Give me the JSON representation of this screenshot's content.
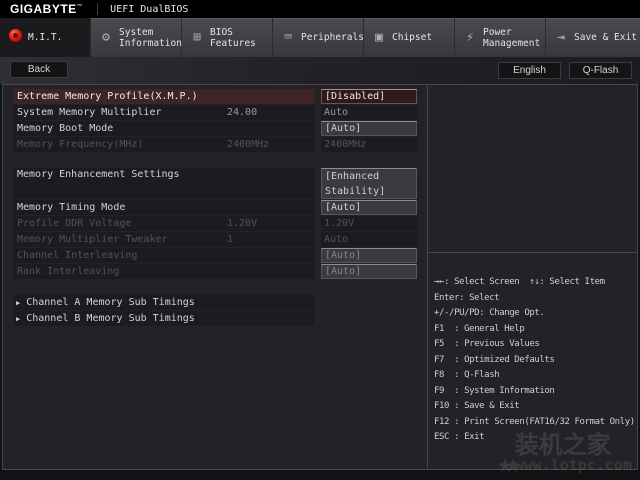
{
  "header": {
    "brand": "GIGABYTE",
    "brand_mark": "™",
    "title": "UEFI DualBIOS"
  },
  "tabs": [
    {
      "name": "mit",
      "label": "M.I.T.",
      "lines": [
        "M.I.T."
      ],
      "icon": "mit-icon",
      "active": true
    },
    {
      "name": "system-information",
      "label": "System Information",
      "lines": [
        "System",
        "Information"
      ],
      "icon": "gear-icon",
      "active": false
    },
    {
      "name": "bios-features",
      "label": "BIOS Features",
      "lines": [
        "BIOS",
        "Features"
      ],
      "icon": "bios-features-icon",
      "active": false
    },
    {
      "name": "peripherals",
      "label": "Peripherals",
      "lines": [
        "Peripherals"
      ],
      "icon": "peripherals-icon",
      "active": false
    },
    {
      "name": "chipset",
      "label": "Chipset",
      "lines": [
        "Chipset"
      ],
      "icon": "chipset-icon",
      "active": false
    },
    {
      "name": "power-management",
      "label": "Power Management",
      "lines": [
        "Power",
        "Management"
      ],
      "icon": "power-icon",
      "active": false
    },
    {
      "name": "save-exit",
      "label": "Save & Exit",
      "lines": [
        "Save & Exit"
      ],
      "icon": "save-exit-icon",
      "active": false
    }
  ],
  "icons": {
    "mit-icon": "red-dot",
    "gear-icon": "⚙",
    "bios-features-icon": "⊞",
    "peripherals-icon": "⌨",
    "chipset-icon": "▣",
    "power-icon": "⚡",
    "save-exit-icon": "⇥",
    "submenu-arrow-icon": "▶"
  },
  "subheader": {
    "back": "Back",
    "language": "English",
    "qflash": "Q-Flash"
  },
  "settings": {
    "rows": [
      {
        "label": "Extreme Memory Profile(X.M.P.)",
        "mid": "",
        "value": "[Disabled]",
        "state": "selected",
        "value_style": "box",
        "gap_before": false,
        "tall": false,
        "submenu": false
      },
      {
        "label": "System Memory Multiplier",
        "mid": "24.00",
        "value": "Auto",
        "state": "normal",
        "value_style": "text",
        "gap_before": false,
        "tall": false,
        "submenu": false
      },
      {
        "label": "Memory Boot Mode",
        "mid": "",
        "value": "[Auto]",
        "state": "normal",
        "value_style": "box",
        "gap_before": false,
        "tall": false,
        "submenu": false
      },
      {
        "label": "Memory Frequency(MHz)",
        "mid": "2400MHz",
        "value": "2400MHz",
        "state": "disabled",
        "value_style": "text",
        "gap_before": false,
        "tall": false,
        "submenu": false
      },
      {
        "label": "Memory Enhancement Settings",
        "mid": "",
        "value": "[Enhanced Stability]",
        "state": "normal",
        "value_style": "box",
        "gap_before": true,
        "tall": true,
        "submenu": false
      },
      {
        "label": "Memory Timing Mode",
        "mid": "",
        "value": "[Auto]",
        "state": "normal",
        "value_style": "box",
        "gap_before": false,
        "tall": false,
        "submenu": false
      },
      {
        "label": "Profile DDR Voltage",
        "mid": "1.20V",
        "value": "1.20V",
        "state": "disabled",
        "value_style": "text",
        "gap_before": false,
        "tall": false,
        "submenu": false
      },
      {
        "label": "Memory Multiplier Tweaker",
        "mid": "1",
        "value": "Auto",
        "state": "disabled",
        "value_style": "text",
        "gap_before": false,
        "tall": false,
        "submenu": false
      },
      {
        "label": "Channel Interleaving",
        "mid": "",
        "value": "[Auto]",
        "state": "disabled",
        "value_style": "box",
        "gap_before": false,
        "tall": false,
        "submenu": false
      },
      {
        "label": "Rank Interleaving",
        "mid": "",
        "value": "[Auto]",
        "state": "disabled",
        "value_style": "box",
        "gap_before": false,
        "tall": false,
        "submenu": false
      },
      {
        "label": "Channel A Memory Sub Timings",
        "mid": "",
        "value": "",
        "state": "normal",
        "value_style": "none",
        "gap_before": true,
        "tall": false,
        "submenu": true
      },
      {
        "label": "Channel B Memory Sub Timings",
        "mid": "",
        "value": "",
        "state": "normal",
        "value_style": "none",
        "gap_before": false,
        "tall": false,
        "submenu": true
      }
    ]
  },
  "help": {
    "lines": [
      "→←: Select Screen  ↑↓: Select Item",
      "Enter: Select",
      "+/-/PU/PD: Change Opt.",
      "F1  : General Help",
      "F5  : Previous Values",
      "F7  : Optimized Defaults",
      "F8  : Q-Flash",
      "F9  : System Information",
      "F10 : Save & Exit",
      "F12 : Print Screen(FAT16/32 Format Only)",
      "ESC : Exit"
    ]
  },
  "watermark": {
    "stars": "★★",
    "line1": "装机之家",
    "line2": "www.lotpc.com"
  },
  "colors": {
    "accent_red": "#d61308",
    "selected_row_bg": "#3e2427",
    "selected_box_bg": "#2e1a1d",
    "value_box_bg": "#3b3b3f",
    "panel_bg": "#232327",
    "tabbar_bg": "#3f3f43"
  }
}
